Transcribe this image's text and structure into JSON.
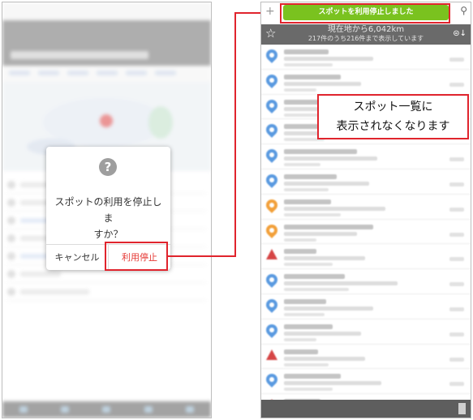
{
  "left_screen": {
    "dialog": {
      "icon": "question-circle-icon",
      "message_line1": "スポットの利用を停止しま",
      "message_line2": "すか？",
      "cancel_label": "キャンセル",
      "confirm_label": "利用停止"
    }
  },
  "right_screen": {
    "toast_message": "スポットを利用停止しました",
    "header": {
      "range_text": "現在地から6,042km",
      "count_text": "217件のうち216件まで表示しています"
    },
    "pin_colors": [
      "#5a9ae0",
      "#5a9ae0",
      "#5a9ae0",
      "#5a9ae0",
      "#5a9ae0",
      "#5a9ae0",
      "#f2a03a",
      "#f2a03a",
      "#d64545",
      "#5a9ae0",
      "#5a9ae0",
      "#5a9ae0",
      "#d64545",
      "#5a9ae0",
      "#d64545"
    ]
  },
  "callout": {
    "line1": "スポット一覧に",
    "line2": "表示されなくなります"
  },
  "colors": {
    "toast_green": "#7ac21f",
    "highlight_red": "#e0242d",
    "stop_button_red": "#e53935"
  }
}
